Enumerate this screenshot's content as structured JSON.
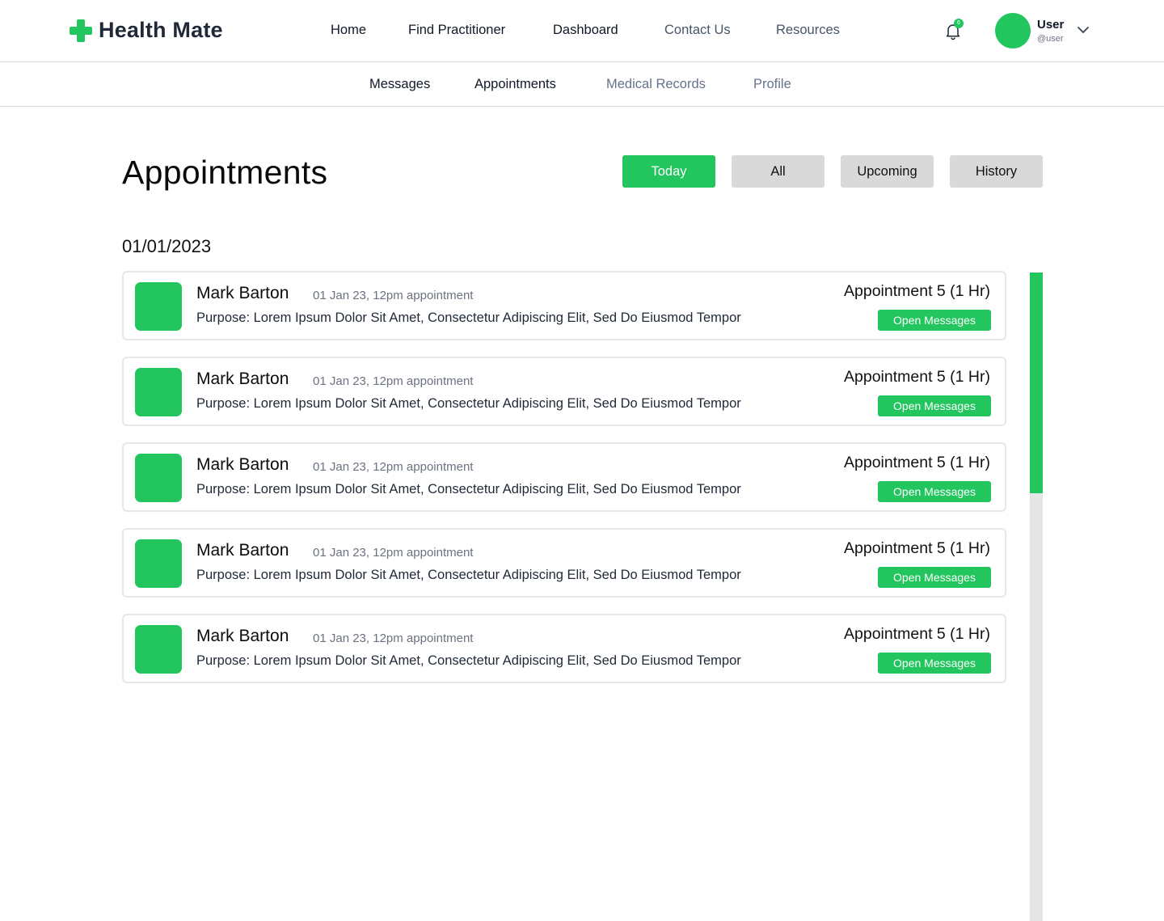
{
  "brand": {
    "name": "Health Mate",
    "icon": "medical-cross-icon",
    "accent_color": "#22c55e"
  },
  "main_nav": [
    {
      "label": "Home",
      "muted": false
    },
    {
      "label": "Find Practitioner",
      "muted": false
    },
    {
      "label": "Dashboard",
      "muted": false
    },
    {
      "label": "Contact Us",
      "muted": true
    },
    {
      "label": "Resources",
      "muted": true
    }
  ],
  "notifications": {
    "icon": "bell-icon",
    "count": "6"
  },
  "user": {
    "name": "User",
    "handle": "@user",
    "menu_icon": "chevron-down-icon"
  },
  "sub_nav": [
    {
      "label": "Messages",
      "muted": false
    },
    {
      "label": "Appointments",
      "muted": false
    },
    {
      "label": "Medical Records",
      "muted": true
    },
    {
      "label": "Profile",
      "muted": true
    }
  ],
  "page": {
    "title": "Appointments",
    "filters": [
      {
        "label": "Today",
        "active": true
      },
      {
        "label": "All",
        "active": false
      },
      {
        "label": "Upcoming",
        "active": false
      },
      {
        "label": "History",
        "active": false
      }
    ],
    "date": "01/01/2023"
  },
  "appointments": [
    {
      "name": "Mark Barton",
      "meta": "01 Jan 23, 12pm appointment",
      "purpose": "Purpose: Lorem Ipsum Dolor Sit Amet, Consectetur Adipiscing Elit, Sed Do Eiusmod Tempor",
      "appointment": "Appointment 5 (1 Hr)",
      "button": "Open Messages"
    },
    {
      "name": "Mark Barton",
      "meta": "01 Jan 23, 12pm appointment",
      "purpose": "Purpose: Lorem Ipsum Dolor Sit Amet, Consectetur Adipiscing Elit, Sed Do Eiusmod Tempor",
      "appointment": "Appointment 5 (1 Hr)",
      "button": "Open Messages"
    },
    {
      "name": "Mark Barton",
      "meta": "01 Jan 23, 12pm appointment",
      "purpose": "Purpose: Lorem Ipsum Dolor Sit Amet, Consectetur Adipiscing Elit, Sed Do Eiusmod Tempor",
      "appointment": "Appointment 5 (1 Hr)",
      "button": "Open Messages"
    },
    {
      "name": "Mark Barton",
      "meta": "01 Jan 23, 12pm appointment",
      "purpose": "Purpose: Lorem Ipsum Dolor Sit Amet, Consectetur Adipiscing Elit, Sed Do Eiusmod Tempor",
      "appointment": "Appointment 5 (1 Hr)",
      "button": "Open Messages"
    },
    {
      "name": "Mark Barton",
      "meta": "01 Jan 23, 12pm appointment",
      "purpose": "Purpose: Lorem Ipsum Dolor Sit Amet, Consectetur Adipiscing Elit, Sed Do Eiusmod Tempor",
      "appointment": "Appointment 5 (1 Hr)",
      "button": "Open Messages"
    }
  ],
  "scrollbar": {
    "thumb_fraction": 0.34
  }
}
